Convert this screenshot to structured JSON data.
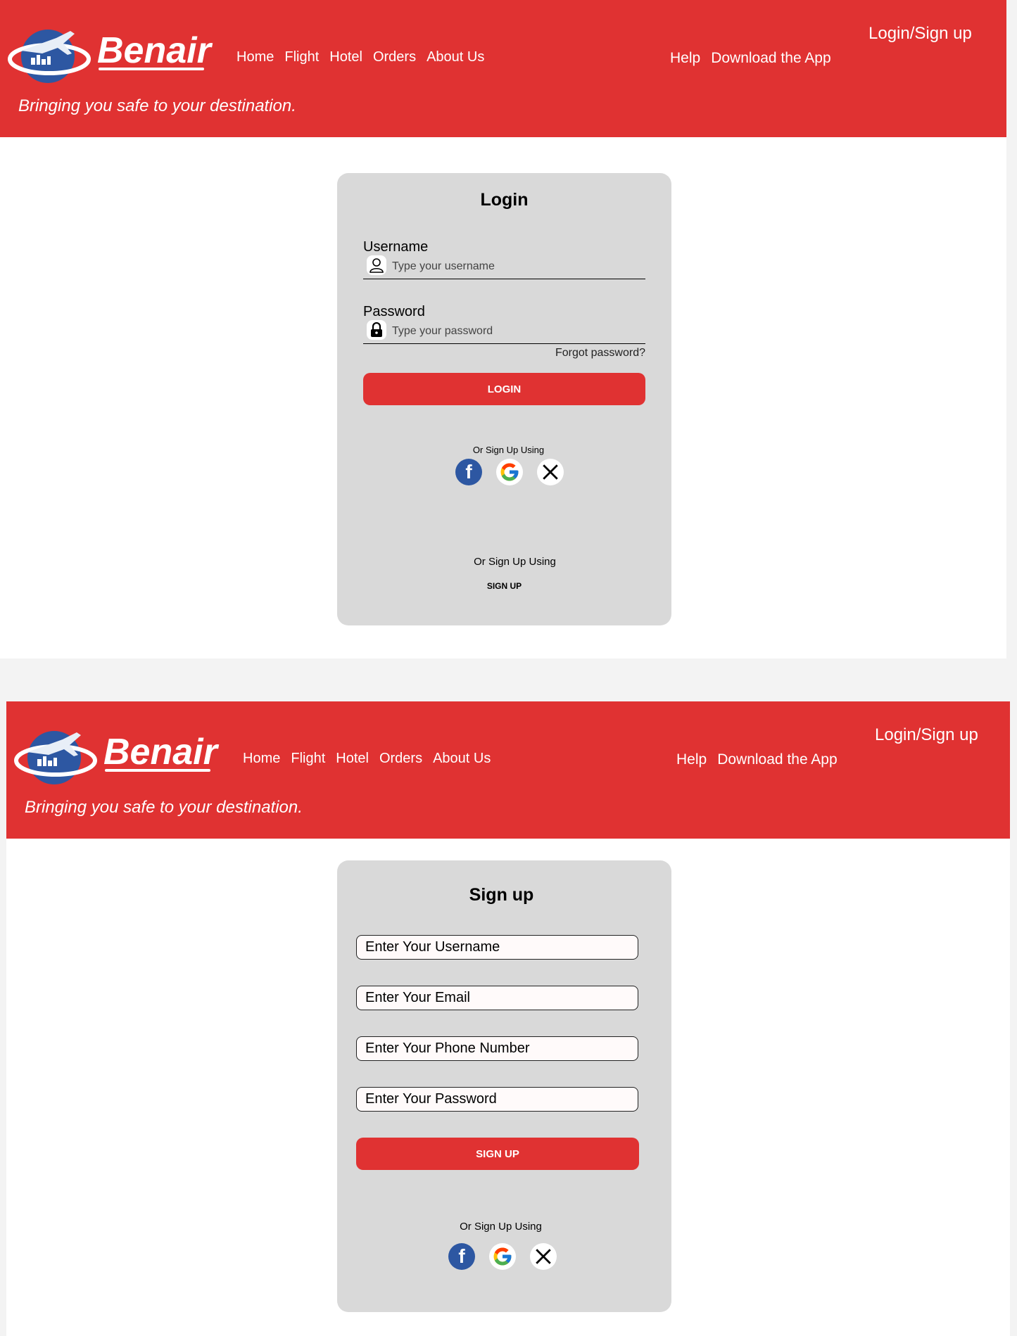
{
  "header": {
    "brand": "Benair",
    "tagline": "Bringing you safe to your destination.",
    "nav": [
      "Home",
      "Flight",
      "Hotel",
      "Orders",
      "About Us"
    ],
    "help": "Help",
    "download": "Download the App",
    "login_signup": "Login/Sign up"
  },
  "login": {
    "title": "Login",
    "username_label": "Username",
    "username_placeholder": "Type your username",
    "password_label": "Password",
    "password_placeholder": "Type your password",
    "forgot": "Forgot password?",
    "login_button": "LOGIN",
    "social_caption": "Or Sign Up Using",
    "signup_caption": "Or  Sign Up Using",
    "signup_link": "SIGN UP"
  },
  "signup": {
    "title": "Sign up",
    "username_placeholder": "Enter Your Username",
    "email_placeholder": "Enter Your Email",
    "phone_placeholder": "Enter Your Phone Number",
    "password_placeholder": "Enter Your Password",
    "signup_button": "SIGN UP",
    "social_caption": "Or Sign Up Using"
  },
  "colors": {
    "brand_red": "#e03232",
    "card_gray": "#d9d9d9",
    "facebook_blue": "#2d57a2"
  },
  "icons": [
    "logo-icon",
    "user-icon",
    "lock-icon",
    "facebook-icon",
    "google-icon",
    "x-icon"
  ]
}
